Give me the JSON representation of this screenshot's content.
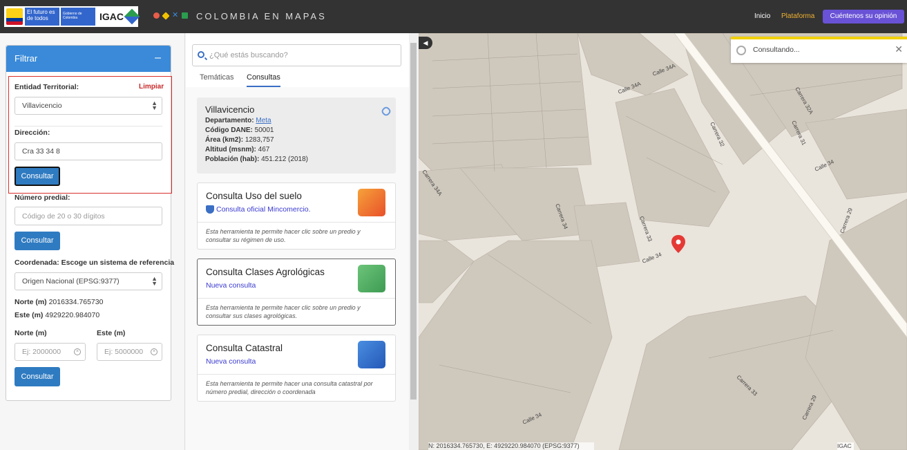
{
  "header": {
    "gov_futuro": "El futuro es de todos",
    "gov_gobierno": "Gobierno de Colombia",
    "igac": "IGAC",
    "brand": "COLOMBIA EN MAPAS",
    "nav_inicio": "Inicio",
    "nav_plataforma": "Plataforma",
    "opinion_button": "Cuéntenos su opinión"
  },
  "filter": {
    "title": "Filtrar",
    "collapse": "–",
    "entidad_label": "Entidad Territorial:",
    "limpiar": "Limpiar",
    "entidad_value": "Villavicencio",
    "direccion_label": "Dirección:",
    "direccion_value": "Cra 33 34 8",
    "consultar": "Consultar",
    "predial_label": "Número predial:",
    "predial_placeholder": "Código de 20 o 30 dígitos",
    "coord_label": "Coordenada: Escoge un sistema de referencia",
    "coord_system": "Origen Nacional (EPSG:9377)",
    "norte_label": "Norte (m)",
    "norte_value": "2016334.765730",
    "este_label": "Este (m)",
    "este_value": "4929220.984070",
    "norte_input_label": "Norte (m)",
    "este_input_label": "Este (m)",
    "norte_placeholder": "Ej: 2000000",
    "este_placeholder": "Ej: 5000000"
  },
  "middle": {
    "search_placeholder": "¿Qué estás buscando?",
    "tabs": [
      "Temáticas",
      "Consultas"
    ],
    "info": {
      "municipio": "Villavicencio",
      "departamento_label": "Departamento:",
      "departamento": "Meta",
      "dane_label": "Código DANE:",
      "dane": "50001",
      "area_label": "Área (km2):",
      "area": "1283,757",
      "altitud_label": "Altitud (msnm):",
      "altitud": "467",
      "poblacion_label": "Población (hab):",
      "poblacion": "451.212 (2018)"
    },
    "cards": [
      {
        "title": "Consulta Uso del suelo",
        "sub": "Consulta oficial Mincomercio.",
        "desc": "Esta herramienta te permite hacer clic sobre un predio y consultar su régimen de uso.",
        "icon": "land-use-icon",
        "color": "#ef6c2c"
      },
      {
        "title": "Consulta Clases Agrológicas",
        "sub": "Nueva consulta",
        "desc": "Esta herramienta te permite hacer clic sobre un predio y consultar sus clases agrológicas.",
        "icon": "plant-icon",
        "color": "#4caf62"
      },
      {
        "title": "Consulta Catastral",
        "sub": "Nueva consulta",
        "desc": "Esta herramienta te permite hacer una consulta catastral por número predial, dirección o coordenada",
        "icon": "cadastre-icon",
        "color": "#2f6fd0"
      }
    ]
  },
  "map": {
    "toast": "Consultando...",
    "coords": "N: 2016334.765730, E: 4929220.984070 (EPSG:9377)",
    "attribution": "IGAC",
    "streets": [
      "Calle 34A",
      "Calle 34A",
      "Calle 34",
      "Calle 34",
      "Calle 34",
      "Carrera 34A",
      "Carrera 34",
      "Carrera 33",
      "Carrera 33",
      "Carrera 32",
      "Carrera 29",
      "Carrera 29",
      "Carrera 32A",
      "Carrera 31"
    ]
  }
}
